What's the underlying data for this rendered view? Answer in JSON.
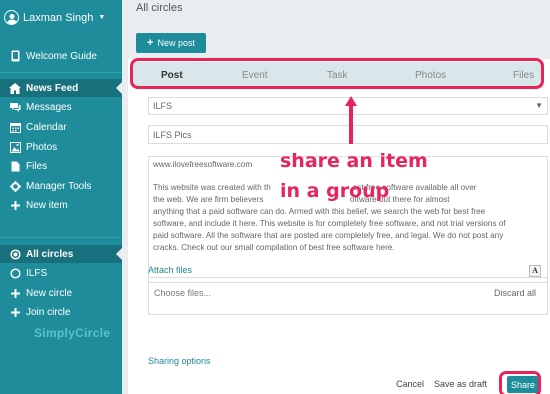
{
  "user": {
    "name": "Laxman Singh"
  },
  "sidebar": {
    "top": [
      {
        "label": "Welcome Guide",
        "icon": "mobile-icon"
      }
    ],
    "items": [
      {
        "label": "News Feed",
        "icon": "home-icon",
        "active": true
      },
      {
        "label": "Messages",
        "icon": "chat-icon"
      },
      {
        "label": "Calendar",
        "icon": "calendar-icon"
      },
      {
        "label": "Photos",
        "icon": "photo-icon"
      },
      {
        "label": "Files",
        "icon": "file-icon"
      },
      {
        "label": "Manager Tools",
        "icon": "gear-icon"
      },
      {
        "label": "New item",
        "icon": "plus-icon"
      }
    ],
    "circles": [
      {
        "label": "All circles",
        "icon": "circle-dot-icon",
        "active": true
      },
      {
        "label": "ILFS",
        "icon": "circle-icon"
      },
      {
        "label": "New circle",
        "icon": "plus-icon"
      },
      {
        "label": "Join circle",
        "icon": "plus-icon"
      }
    ],
    "brand": "SimplyCircle"
  },
  "main": {
    "breadcrumb": "All circles",
    "new_post_label": "New post",
    "tabs": [
      {
        "label": "Post",
        "active": true
      },
      {
        "label": "Event"
      },
      {
        "label": "Task"
      },
      {
        "label": "Photos"
      },
      {
        "label": "Files"
      }
    ],
    "group_select": "ILFS",
    "title_value": "ILFS Pics",
    "body_url": "www.ilovefreesoftware.com",
    "body_lines": [
      "This website was created with th                                    est free software available all over",
      "the web. We are firm believers                                      oftware out there for almost",
      "anything that a paid software can do. Armed with this belief, we search the web for best free",
      "software, and include it here. This website is for completely free software, and not trial versions of",
      "paid software. All the software that are posted are completely free, and legal. We do not post any",
      "cracks. Check out our small compilation of best free software here."
    ],
    "format_button": "A",
    "attach_label": "Attach files",
    "choose_files": "Choose files...",
    "discard_all": "Discard all",
    "sharing_options": "Sharing options",
    "cancel": "Cancel",
    "save_draft": "Save as draft",
    "share": "Share"
  },
  "annotation": {
    "line1": "share an item",
    "line2": "in a group",
    "color": "#e8245d"
  },
  "colors": {
    "sidebar_bg": "#1e8c9a",
    "accent": "#1e8c9a",
    "annotation": "#e8245d"
  }
}
